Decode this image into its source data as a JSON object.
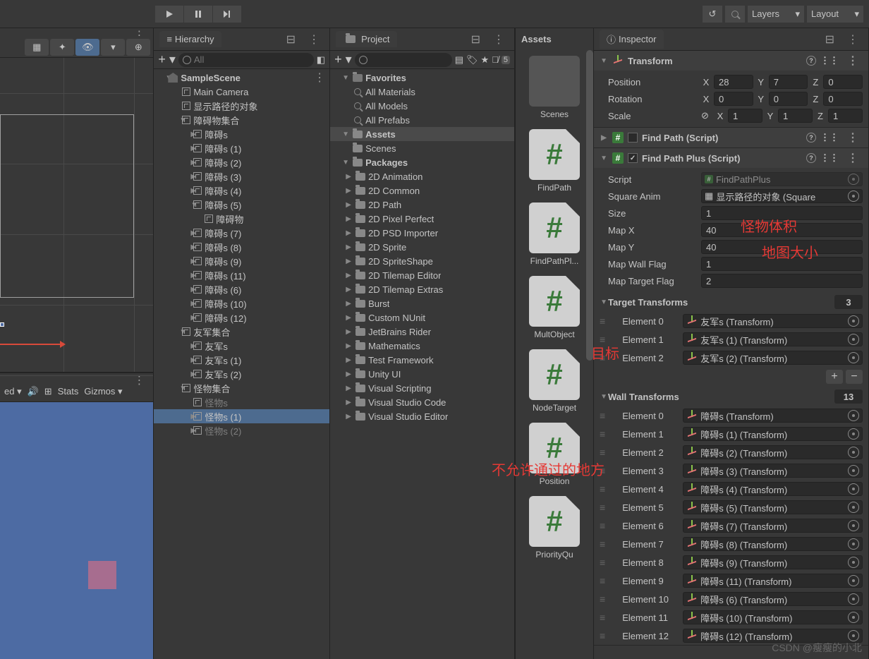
{
  "top": {
    "layers": "Layers",
    "layout": "Layout"
  },
  "hierarchy": {
    "title": "Hierarchy",
    "search_placeholder": "All",
    "scene": "SampleScene",
    "items": [
      {
        "name": "Main Camera",
        "depth": 1
      },
      {
        "name": "显示路径的对象",
        "depth": 1
      },
      {
        "name": "障碍物集合",
        "depth": 1,
        "fold": "▼"
      },
      {
        "name": "障碍s",
        "depth": 2,
        "fold": "▶"
      },
      {
        "name": "障碍s (1)",
        "depth": 2,
        "fold": "▶"
      },
      {
        "name": "障碍s (2)",
        "depth": 2,
        "fold": "▶"
      },
      {
        "name": "障碍s (3)",
        "depth": 2,
        "fold": "▶"
      },
      {
        "name": "障碍s (4)",
        "depth": 2,
        "fold": "▶"
      },
      {
        "name": "障碍s (5)",
        "depth": 2,
        "fold": "▼"
      },
      {
        "name": "障碍物",
        "depth": 3
      },
      {
        "name": "障碍s (7)",
        "depth": 2,
        "fold": "▶"
      },
      {
        "name": "障碍s (8)",
        "depth": 2,
        "fold": "▶"
      },
      {
        "name": "障碍s (9)",
        "depth": 2,
        "fold": "▶"
      },
      {
        "name": "障碍s (11)",
        "depth": 2,
        "fold": "▶"
      },
      {
        "name": "障碍s (6)",
        "depth": 2,
        "fold": "▶"
      },
      {
        "name": "障碍s (10)",
        "depth": 2,
        "fold": "▶"
      },
      {
        "name": "障碍s (12)",
        "depth": 2,
        "fold": "▶"
      },
      {
        "name": "友军集合",
        "depth": 1,
        "fold": "▼"
      },
      {
        "name": "友军s",
        "depth": 2,
        "fold": "▶"
      },
      {
        "name": "友军s (1)",
        "depth": 2,
        "fold": "▶"
      },
      {
        "name": "友军s (2)",
        "depth": 2,
        "fold": "▶"
      },
      {
        "name": "怪物集合",
        "depth": 1,
        "fold": "▼"
      },
      {
        "name": "怪物s",
        "depth": 2,
        "dim": true
      },
      {
        "name": "怪物s (1)",
        "depth": 2,
        "fold": "▶",
        "selected": true
      },
      {
        "name": "怪物s (2)",
        "depth": 2,
        "fold": "▶",
        "dim": true
      }
    ]
  },
  "project": {
    "title": "Project",
    "favorites": "Favorites",
    "fav_items": [
      "All Materials",
      "All Models",
      "All Prefabs"
    ],
    "assets": "Assets",
    "assets_items": [
      "Scenes"
    ],
    "packages": "Packages",
    "package_items": [
      "2D Animation",
      "2D Common",
      "2D Path",
      "2D Pixel Perfect",
      "2D PSD Importer",
      "2D Sprite",
      "2D SpriteShape",
      "2D Tilemap Editor",
      "2D Tilemap Extras",
      "Burst",
      "Custom NUnit",
      "JetBrains Rider",
      "Mathematics",
      "Test Framework",
      "Unity UI",
      "Visual Scripting",
      "Visual Studio Code",
      "Visual Studio Editor"
    ]
  },
  "assets_grid": {
    "header": "Assets",
    "items": [
      {
        "name": "Scenes",
        "type": "folder"
      },
      {
        "name": "FindPath",
        "type": "script"
      },
      {
        "name": "FindPathPl...",
        "type": "script"
      },
      {
        "name": "MultObject",
        "type": "script"
      },
      {
        "name": "NodeTarget",
        "type": "script"
      },
      {
        "name": "Position",
        "type": "script"
      },
      {
        "name": "PriorityQu",
        "type": "script"
      }
    ]
  },
  "inspector": {
    "title": "Inspector",
    "transform": {
      "title": "Transform",
      "position_lbl": "Position",
      "rotation_lbl": "Rotation",
      "scale_lbl": "Scale",
      "pos": {
        "x": "28",
        "y": "7",
        "z": "0"
      },
      "rot": {
        "x": "0",
        "y": "0",
        "z": "0"
      },
      "scale": {
        "x": "1",
        "y": "1",
        "z": "1"
      }
    },
    "findpath": {
      "title": "Find Path (Script)"
    },
    "findpathplus": {
      "title": "Find Path Plus (Script)",
      "script_lbl": "Script",
      "script_val": "FindPathPlus",
      "anim_lbl": "Square Anim",
      "anim_val": "显示路径的对象 (Square",
      "size_lbl": "Size",
      "size_val": "1",
      "mapx_lbl": "Map X",
      "mapx_val": "40",
      "mapy_lbl": "Map Y",
      "mapy_val": "40",
      "wallflag_lbl": "Map Wall Flag",
      "wallflag_val": "1",
      "targetflag_lbl": "Map Target Flag",
      "targetflag_val": "2",
      "targets_lbl": "Target Transforms",
      "targets_count": "3",
      "targets": [
        {
          "label": "Element 0",
          "val": "友军s (Transform)"
        },
        {
          "label": "Element 1",
          "val": "友军s (1) (Transform)"
        },
        {
          "label": "Element 2",
          "val": "友军s (2) (Transform)"
        }
      ],
      "walls_lbl": "Wall Transforms",
      "walls_count": "13",
      "walls": [
        {
          "label": "Element 0",
          "val": "障碍s (Transform)"
        },
        {
          "label": "Element 1",
          "val": "障碍s (1) (Transform)"
        },
        {
          "label": "Element 2",
          "val": "障碍s (2) (Transform)"
        },
        {
          "label": "Element 3",
          "val": "障碍s (3) (Transform)"
        },
        {
          "label": "Element 4",
          "val": "障碍s (4) (Transform)"
        },
        {
          "label": "Element 5",
          "val": "障碍s (5) (Transform)"
        },
        {
          "label": "Element 6",
          "val": "障碍s (7) (Transform)"
        },
        {
          "label": "Element 7",
          "val": "障碍s (8) (Transform)"
        },
        {
          "label": "Element 8",
          "val": "障碍s (9) (Transform)"
        },
        {
          "label": "Element 9",
          "val": "障碍s (11) (Transform)"
        },
        {
          "label": "Element 10",
          "val": "障碍s (6) (Transform)"
        },
        {
          "label": "Element 11",
          "val": "障碍s (10) (Transform)"
        },
        {
          "label": "Element 12",
          "val": "障碍s (12) (Transform)"
        }
      ]
    }
  },
  "game_toolbar": {
    "stats": "Stats",
    "gizmos": "Gizmos"
  },
  "annotations": {
    "size": "怪物体积",
    "map": "地图大小",
    "target": "目标",
    "wall": "不允许通过的地方"
  },
  "watermark": "CSDN @瘦瘦的小北",
  "axis": {
    "x": "X",
    "y": "Y",
    "z": "Z"
  }
}
